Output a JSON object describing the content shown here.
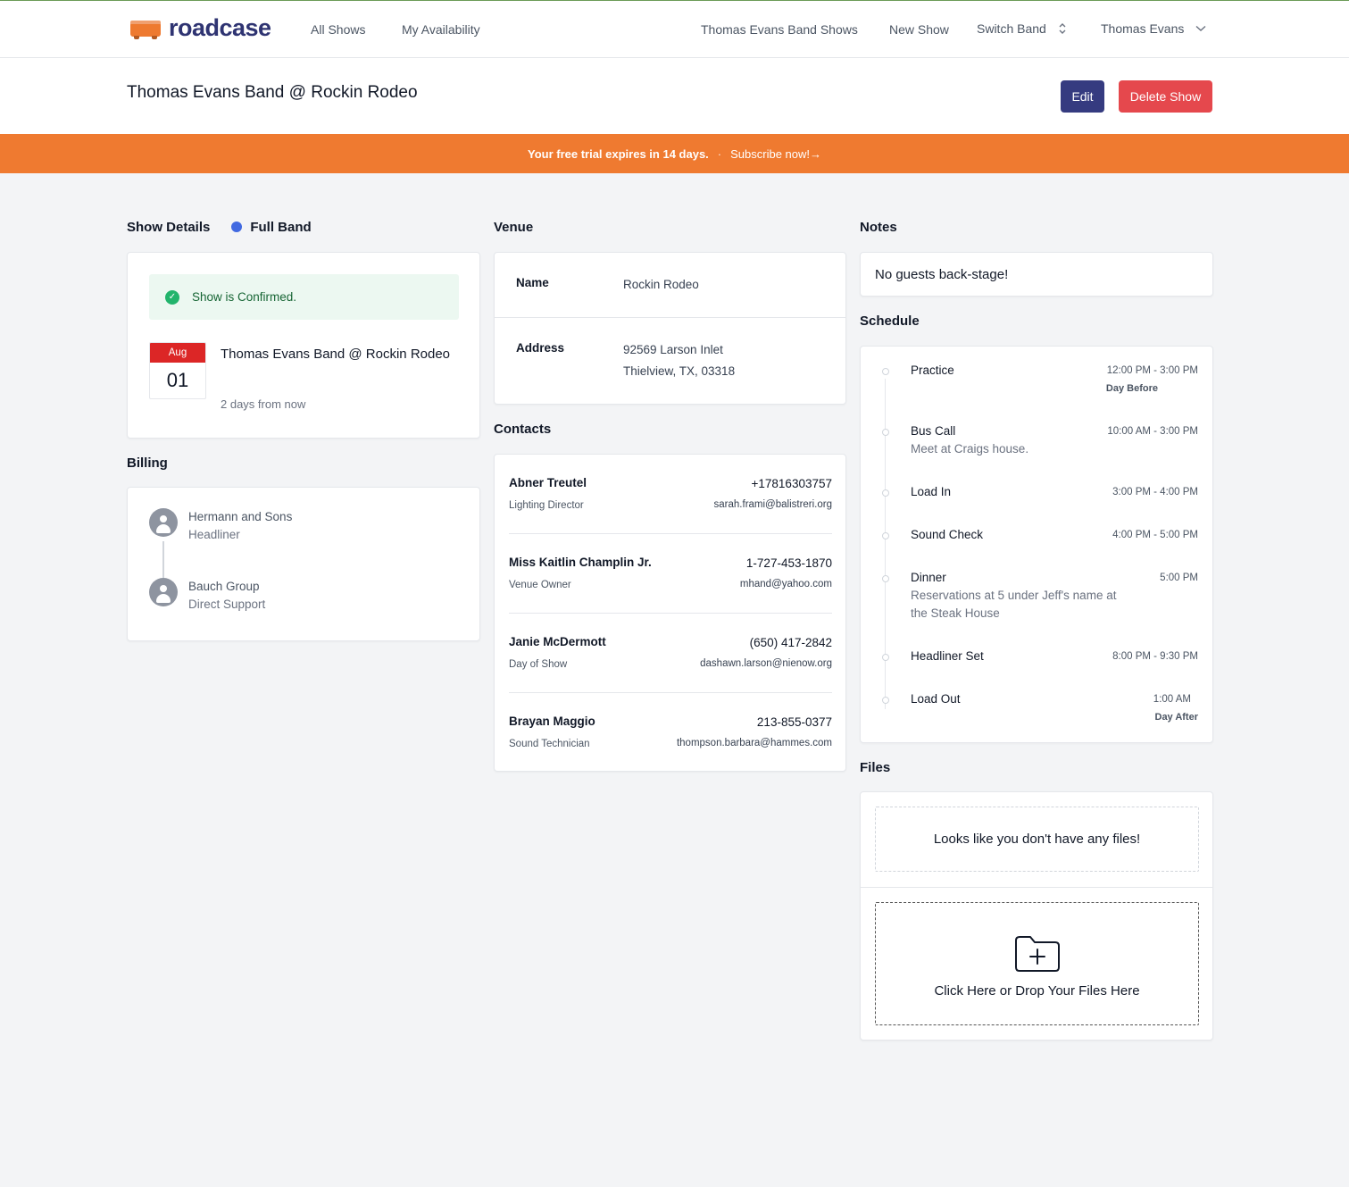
{
  "app": {
    "logo_text": "roadcase"
  },
  "nav": {
    "all_shows": "All Shows",
    "my_availability": "My Availability",
    "band_shows": "Thomas Evans Band Shows",
    "new_show": "New Show",
    "switch_band": "Switch Band",
    "user": "Thomas Evans"
  },
  "page": {
    "title": "Thomas Evans Band @ Rockin Rodeo",
    "edit_label": "Edit",
    "delete_label": "Delete Show"
  },
  "banner": {
    "message": "Your free trial expires in 14 days.",
    "separator": "·",
    "cta": "Subscribe now!",
    "arrow": "→"
  },
  "show_details": {
    "section_title": "Show Details",
    "lineup": "Full Band",
    "lineup_color": "#4169e1",
    "status": "Show is Confirmed.",
    "month": "Aug",
    "day": "01",
    "event_title": "Thomas Evans Band @ Rockin Rodeo",
    "relative": "2 days from now"
  },
  "billing": {
    "section_title": "Billing",
    "items": [
      {
        "name": "Hermann and Sons",
        "role": "Headliner"
      },
      {
        "name": "Bauch Group",
        "role": "Direct Support"
      }
    ]
  },
  "venue": {
    "section_title": "Venue",
    "name_label": "Name",
    "name": "Rockin Rodeo",
    "address_label": "Address",
    "address_line1": "92569 Larson Inlet",
    "address_line2": "Thielview, TX, 03318"
  },
  "contacts": {
    "section_title": "Contacts",
    "items": [
      {
        "name": "Abner Treutel",
        "role": "Lighting Director",
        "phone": "+17816303757",
        "email": "sarah.frami@balistreri.org"
      },
      {
        "name": "Miss Kaitlin Champlin Jr.",
        "role": "Venue Owner",
        "phone": "1-727-453-1870",
        "email": "mhand@yahoo.com"
      },
      {
        "name": "Janie McDermott",
        "role": "Day of Show",
        "phone": "(650) 417-2842",
        "email": "dashawn.larson@nienow.org"
      },
      {
        "name": "Brayan Maggio",
        "role": "Sound Technician",
        "phone": "213-855-0377",
        "email": "thompson.barbara@hammes.com"
      }
    ]
  },
  "notes": {
    "section_title": "Notes",
    "text": "No guests back-stage!"
  },
  "schedule": {
    "section_title": "Schedule",
    "items": [
      {
        "name": "Practice",
        "time": "12:00 PM - 3:00 PM",
        "relative": "Day Before",
        "desc": ""
      },
      {
        "name": "Bus Call",
        "time": "10:00 AM - 3:00 PM",
        "relative": "",
        "desc": "Meet at Craigs house."
      },
      {
        "name": "Load In",
        "time": "3:00 PM - 4:00 PM",
        "relative": "",
        "desc": ""
      },
      {
        "name": "Sound Check",
        "time": "4:00 PM - 5:00 PM",
        "relative": "",
        "desc": ""
      },
      {
        "name": "Dinner",
        "time": "5:00 PM",
        "relative": "",
        "desc": "Reservations at 5 under Jeff's name at the Steak House"
      },
      {
        "name": "Headliner Set",
        "time": "8:00 PM - 9:30 PM",
        "relative": "",
        "desc": ""
      },
      {
        "name": "Load Out",
        "time": "1:00 AM",
        "relative": "Day After",
        "desc": ""
      }
    ]
  },
  "files": {
    "section_title": "Files",
    "empty_message": "Looks like you don't have any files!",
    "dropzone_label": "Click Here or Drop Your Files Here"
  },
  "icons": {
    "check": "check-circle-icon",
    "avatar": "user-avatar-icon",
    "folder": "folder-plus-icon",
    "updown": "chevron-up-down-icon",
    "chevron": "chevron-down-icon"
  }
}
